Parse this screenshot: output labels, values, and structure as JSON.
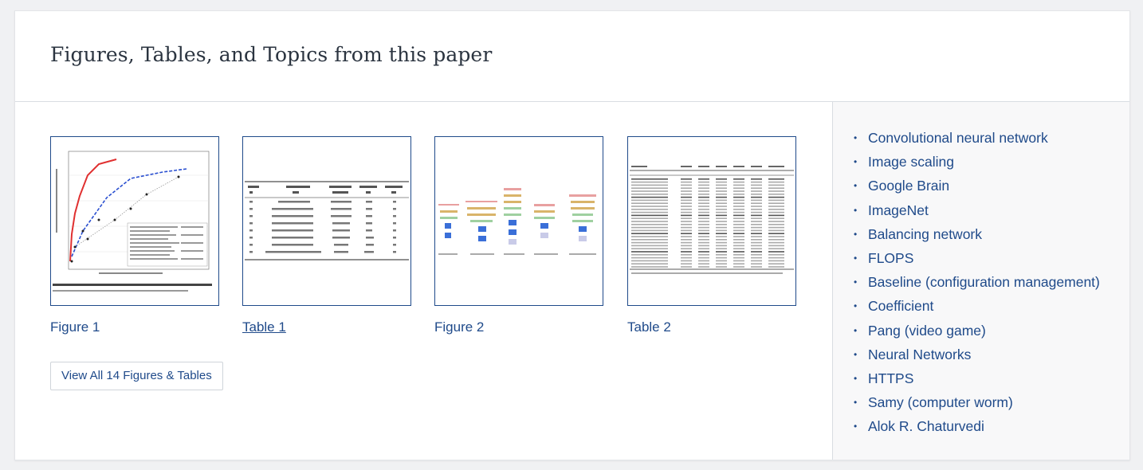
{
  "header": {
    "title": "Figures, Tables, and Topics from this paper"
  },
  "figures": [
    {
      "caption": "Figure 1",
      "kind": "chart",
      "underlined": false
    },
    {
      "caption": "Table 1",
      "kind": "table",
      "underlined": true
    },
    {
      "caption": "Figure 2",
      "kind": "diagram",
      "underlined": false
    },
    {
      "caption": "Table 2",
      "kind": "table",
      "underlined": false
    }
  ],
  "view_all_label": "View All 14 Figures & Tables",
  "topics": [
    "Convolutional neural network",
    "Image scaling",
    "Google Brain",
    "ImageNet",
    "Balancing network",
    "FLOPS",
    "Baseline (configuration management)",
    "Coefficient",
    "Pang (video game)",
    "Neural Networks",
    "HTTPS",
    "Samy (computer worm)",
    "Alok R. Chaturvedi"
  ],
  "colors": {
    "link": "#1f4a8a",
    "background": "#f0f1f3",
    "card": "#ffffff",
    "topics_bg": "#f8f8f9"
  }
}
